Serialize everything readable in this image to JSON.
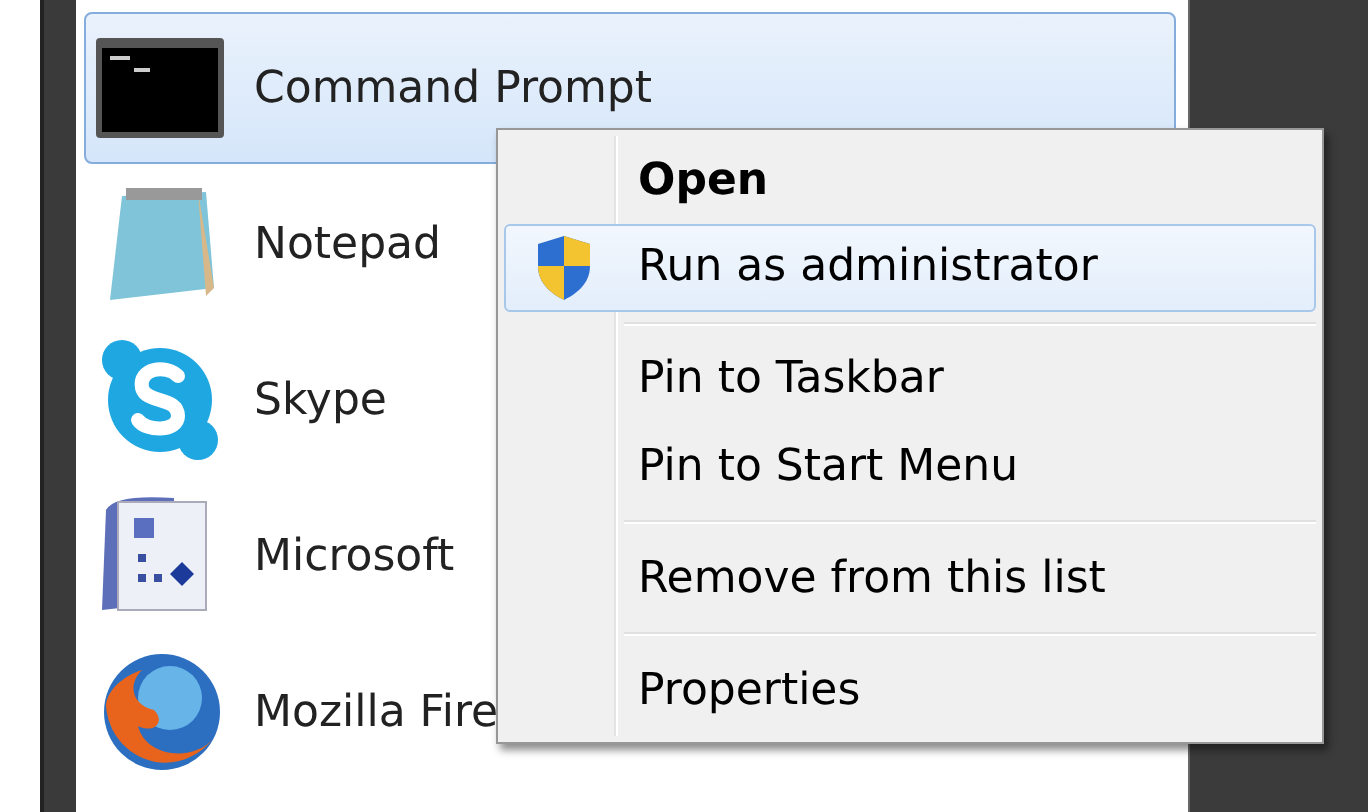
{
  "programs": [
    {
      "label": "Command Prompt",
      "kind": "console",
      "selected": true
    },
    {
      "label": "Notepad",
      "kind": "notepad",
      "selected": false
    },
    {
      "label": "Skype",
      "kind": "skype",
      "selected": false
    },
    {
      "label": "Microsoft",
      "kind": "diagram",
      "selected": false
    },
    {
      "label": "Mozilla Fire",
      "kind": "globe",
      "selected": false
    }
  ],
  "context_menu": {
    "items": [
      {
        "kind": "item",
        "label": "Open",
        "default": true,
        "selected": false
      },
      {
        "kind": "shield_item",
        "label": "Run as administrator",
        "default": false,
        "selected": true
      },
      {
        "kind": "separator"
      },
      {
        "kind": "item",
        "label": "Pin to Taskbar",
        "default": false,
        "selected": false
      },
      {
        "kind": "item",
        "label": "Pin to Start Menu",
        "default": false,
        "selected": false
      },
      {
        "kind": "separator"
      },
      {
        "kind": "item",
        "label": "Remove from this list",
        "default": false,
        "selected": false
      },
      {
        "kind": "separator"
      },
      {
        "kind": "item",
        "label": "Properties",
        "default": false,
        "selected": false
      }
    ]
  }
}
